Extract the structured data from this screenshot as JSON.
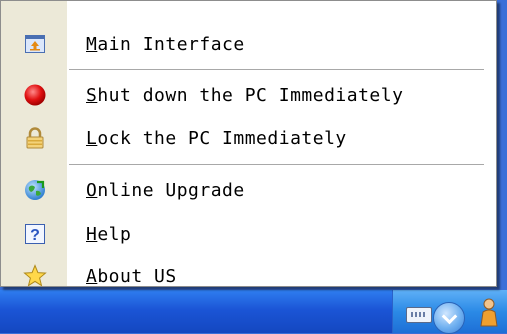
{
  "menu": {
    "items": [
      {
        "accel": "M",
        "rest": "ain Interface",
        "icon": "app-window-icon"
      },
      {
        "accel": "S",
        "rest": "hut down the PC Immediately",
        "icon": "red-circle-icon"
      },
      {
        "accel": "L",
        "rest": "ock the PC Immediately",
        "icon": "lock-icon"
      },
      {
        "accel": "O",
        "rest": "nline Upgrade",
        "icon": "globe-icon"
      },
      {
        "accel": "H",
        "rest": "elp",
        "icon": "help-icon"
      },
      {
        "accel": "A",
        "rest": "bout US",
        "icon": "star-icon"
      }
    ]
  },
  "colors": {
    "menu_background": "#ffffff",
    "icon_column": "#ece9d8",
    "taskbar": "#1b55d6"
  }
}
